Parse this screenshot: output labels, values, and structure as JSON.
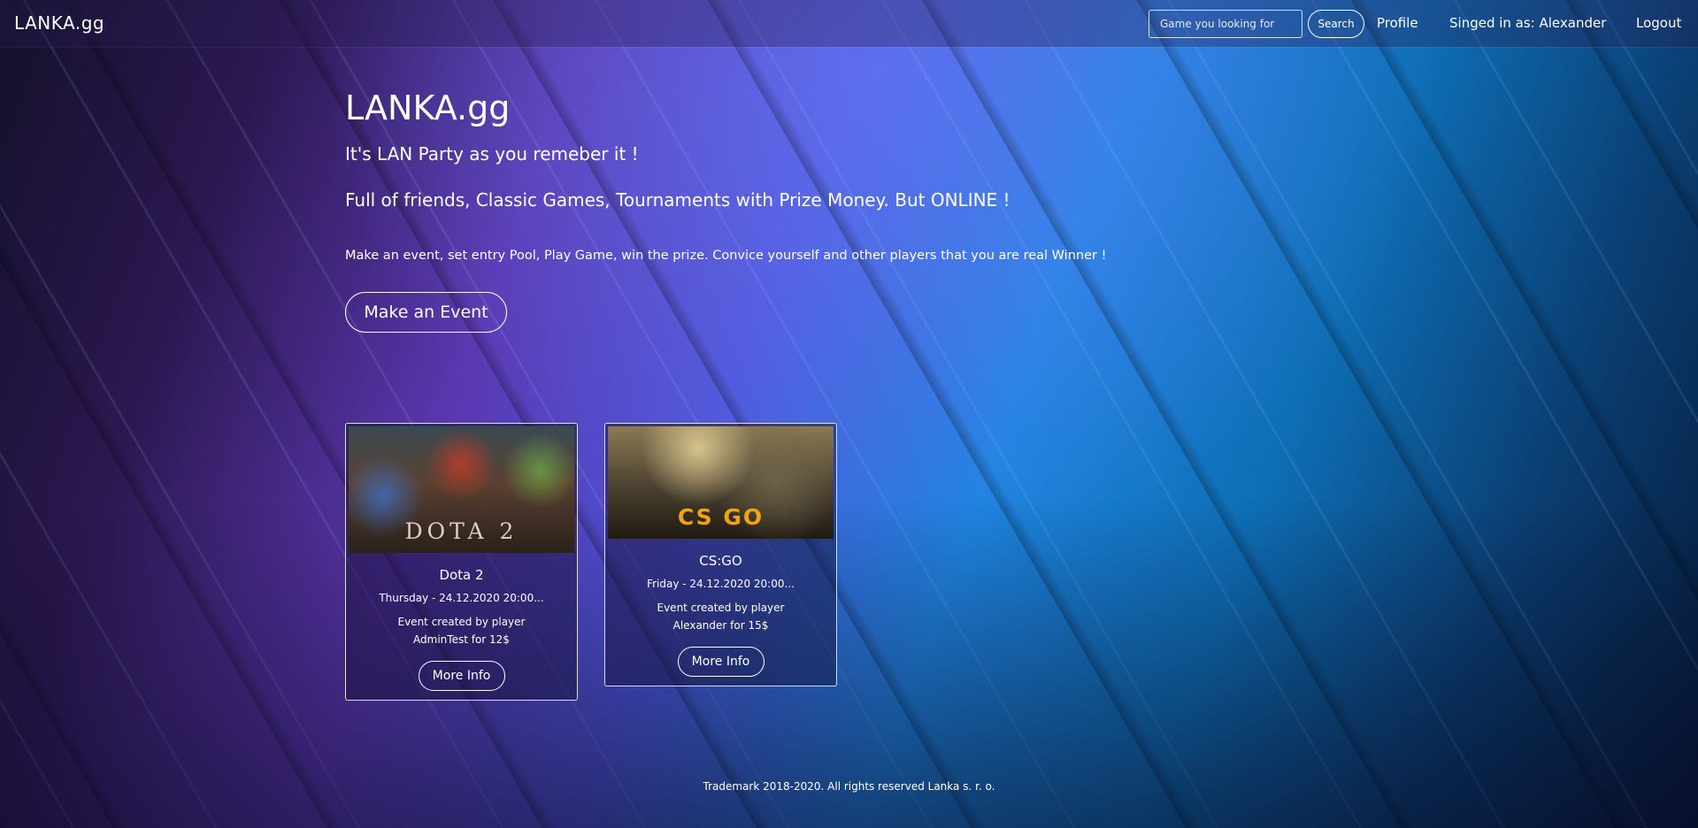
{
  "nav": {
    "brand": "LANKA.gg",
    "search_placeholder": "Game you looking for",
    "search_button": "Search",
    "profile": "Profile",
    "signed_in": "Singed in as: Alexander",
    "logout": "Logout"
  },
  "hero": {
    "title": "LANKA.gg",
    "tagline": "It's LAN Party as you remeber it !",
    "subtagline": "Full of friends, Classic Games, Tournaments with Prize Money. But ONLINE !",
    "description": "Make an event, set entry Pool, Play Game, win the prize. Convice yourself and other players that you are real Winner !",
    "cta": "Make an Event"
  },
  "events": [
    {
      "image_label": "DOTA 2",
      "game": "Dota 2",
      "date": "Thursday - 24.12.2020 20:00...",
      "creator": "Event created by player AdminTest for 12$",
      "button": "More Info"
    },
    {
      "image_label": "CS GO",
      "game": "CS:GO",
      "date": "Friday - 24.12.2020 20:00...",
      "creator": "Event created by player Alexander for 15$",
      "button": "More Info"
    }
  ],
  "footer": "Trademark 2018-2020. All rights reserved Lanka s. r. o."
}
